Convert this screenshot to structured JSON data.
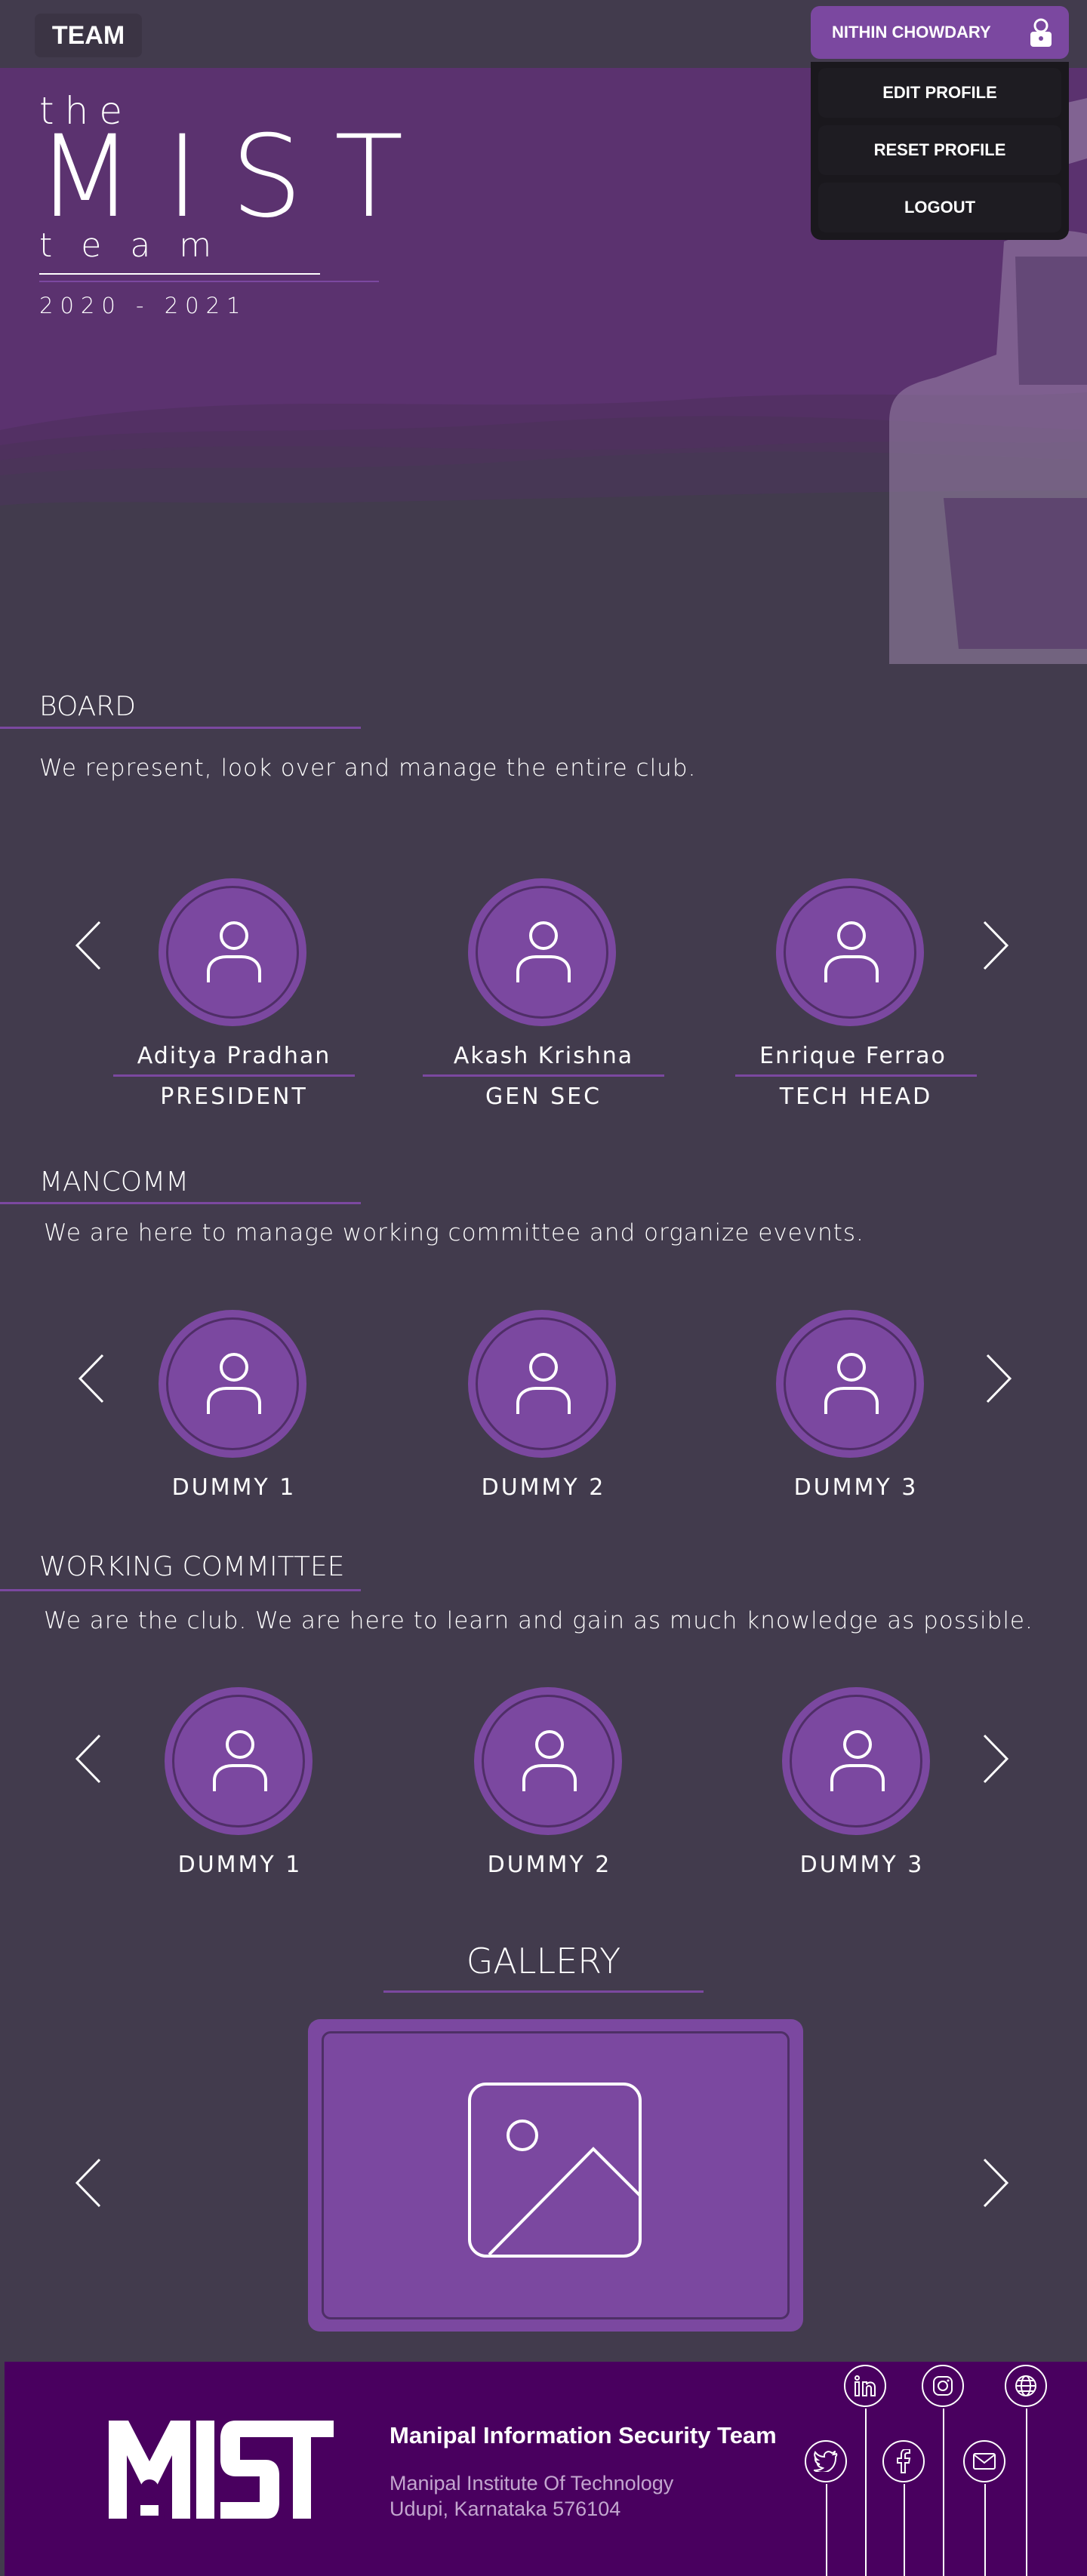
{
  "header": {
    "brand_tag": "TEAM",
    "user_name": "NITHIN CHOWDARY",
    "menu": [
      "EDIT PROFILE",
      "RESET PROFILE",
      "LOGOUT"
    ]
  },
  "hero": {
    "logo_the": "the",
    "logo_mist": "MIST",
    "logo_team": "team",
    "year": "2020 - 2021"
  },
  "board": {
    "title": "BOARD",
    "description": "We represent, look over and manage the entire club.",
    "members": [
      {
        "name": "Aditya Pradhan",
        "role": "PRESIDENT"
      },
      {
        "name": "Akash Krishna",
        "role": "GEN SEC"
      },
      {
        "name": "Enrique Ferrao",
        "role": "TECH HEAD"
      }
    ]
  },
  "mancomm": {
    "title": "MANCOMM",
    "description": "We are here to manage working committee and organize evevnts.",
    "members": [
      "DUMMY 1",
      "DUMMY 2",
      "DUMMY 3"
    ]
  },
  "working_committee": {
    "title": "WORKING COMMITTEE",
    "description": "We are the club. We are here to learn and gain as much knowledge as possible.",
    "members": [
      "DUMMY 1",
      "DUMMY 2",
      "DUMMY 3"
    ]
  },
  "gallery": {
    "title": "GALLERY"
  },
  "footer": {
    "org_name": "Manipal Information Security Team",
    "address_line1": "Manipal Institute Of Technology",
    "address_line2": "Udupi, Karnataka 576104",
    "social_icons": [
      "linkedin-icon",
      "instagram-icon",
      "globe-icon",
      "twitter-icon",
      "facebook-icon",
      "mail-icon"
    ]
  },
  "colors": {
    "background": "#423b4d",
    "accent": "#7b48a0",
    "footer": "#49005f"
  }
}
